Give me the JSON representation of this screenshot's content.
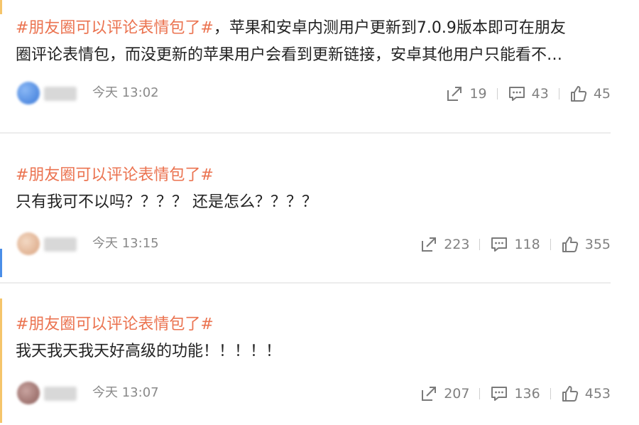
{
  "posts": [
    {
      "topic": "#朋友圈可以评论表情包了#",
      "text_line1": "，苹果和安卓内测用户更新到7.0.9版本即可在朋友",
      "text_line2": "圈评论表情包，而没更新的苹果用户会看到更新链接，安卓其他用户只能看不…",
      "time": "今天 13:02",
      "repost_count": "19",
      "comment_count": "43",
      "like_count": "45"
    },
    {
      "topic": "#朋友圈可以评论表情包了#",
      "text": "只有我可不以吗？？？？ 还是怎么？？？？",
      "time": "今天 13:15",
      "repost_count": "223",
      "comment_count": "118",
      "like_count": "355"
    },
    {
      "topic": "#朋友圈可以评论表情包了#",
      "text": "我天我天我天好高级的功能！！！！！",
      "time": "今天 13:07",
      "repost_count": "207",
      "comment_count": "136",
      "like_count": "453"
    }
  ],
  "icons": {
    "repost": "share-arrow-icon",
    "comment": "comment-bubble-icon",
    "like": "thumbs-up-icon"
  },
  "colors": {
    "topic": "#eb7350",
    "text": "#222222",
    "meta": "#808080",
    "divider": "#ececec"
  }
}
